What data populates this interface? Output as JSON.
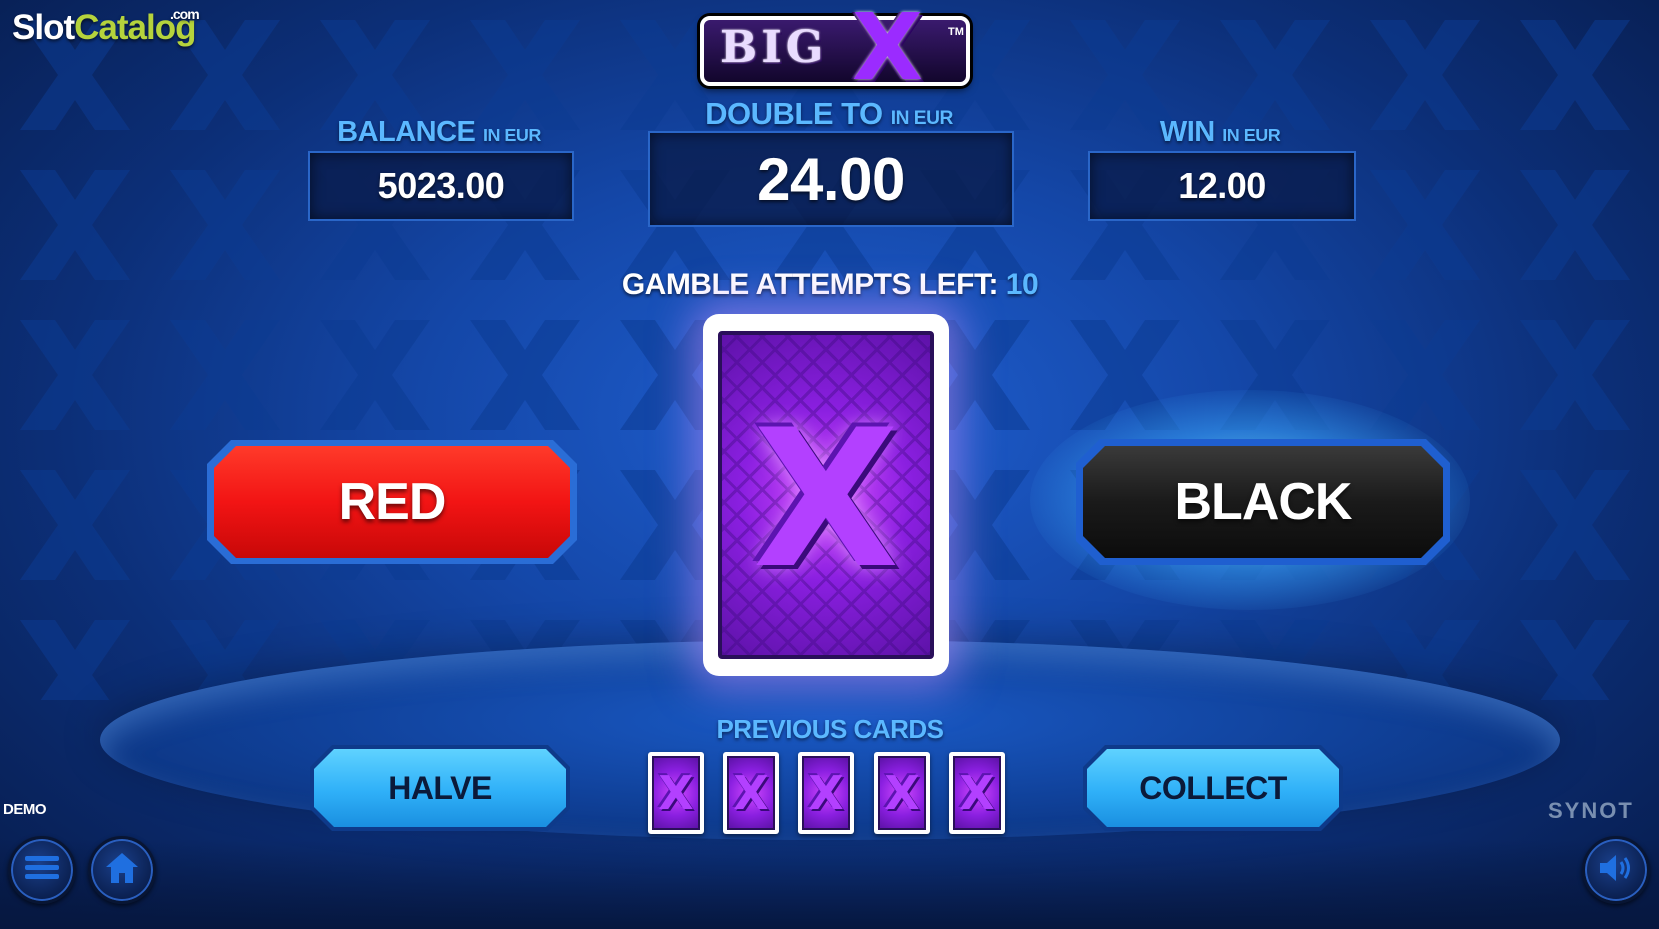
{
  "watermark": {
    "part1": "Slot",
    "part2": "Catalog",
    "com": ".com"
  },
  "logo": {
    "word": "BIG",
    "letter": "X",
    "tm": "TM"
  },
  "balance": {
    "label": "BALANCE",
    "unit": "IN EUR",
    "value": "5023.00"
  },
  "double_to": {
    "label": "DOUBLE TO",
    "unit": "IN EUR",
    "value": "24.00"
  },
  "win": {
    "label": "WIN",
    "unit": "IN EUR",
    "value": "12.00"
  },
  "attempts": {
    "label": "GAMBLE ATTEMPTS LEFT:",
    "count": "10"
  },
  "buttons": {
    "red": "RED",
    "black": "BLACK",
    "halve": "HALVE",
    "collect": "COLLECT"
  },
  "previous_cards": {
    "label": "PREVIOUS CARDS",
    "cards": [
      "X",
      "X",
      "X",
      "X",
      "X"
    ]
  },
  "footer": {
    "demo": "DEMO",
    "provider": "SYNOT"
  },
  "icons": {
    "menu": "menu-icon",
    "home": "home-icon",
    "sound": "speaker-icon"
  },
  "colors": {
    "accent": "#5bb8ff",
    "red": "#f21414",
    "card_purple": "#8a1fe0"
  }
}
